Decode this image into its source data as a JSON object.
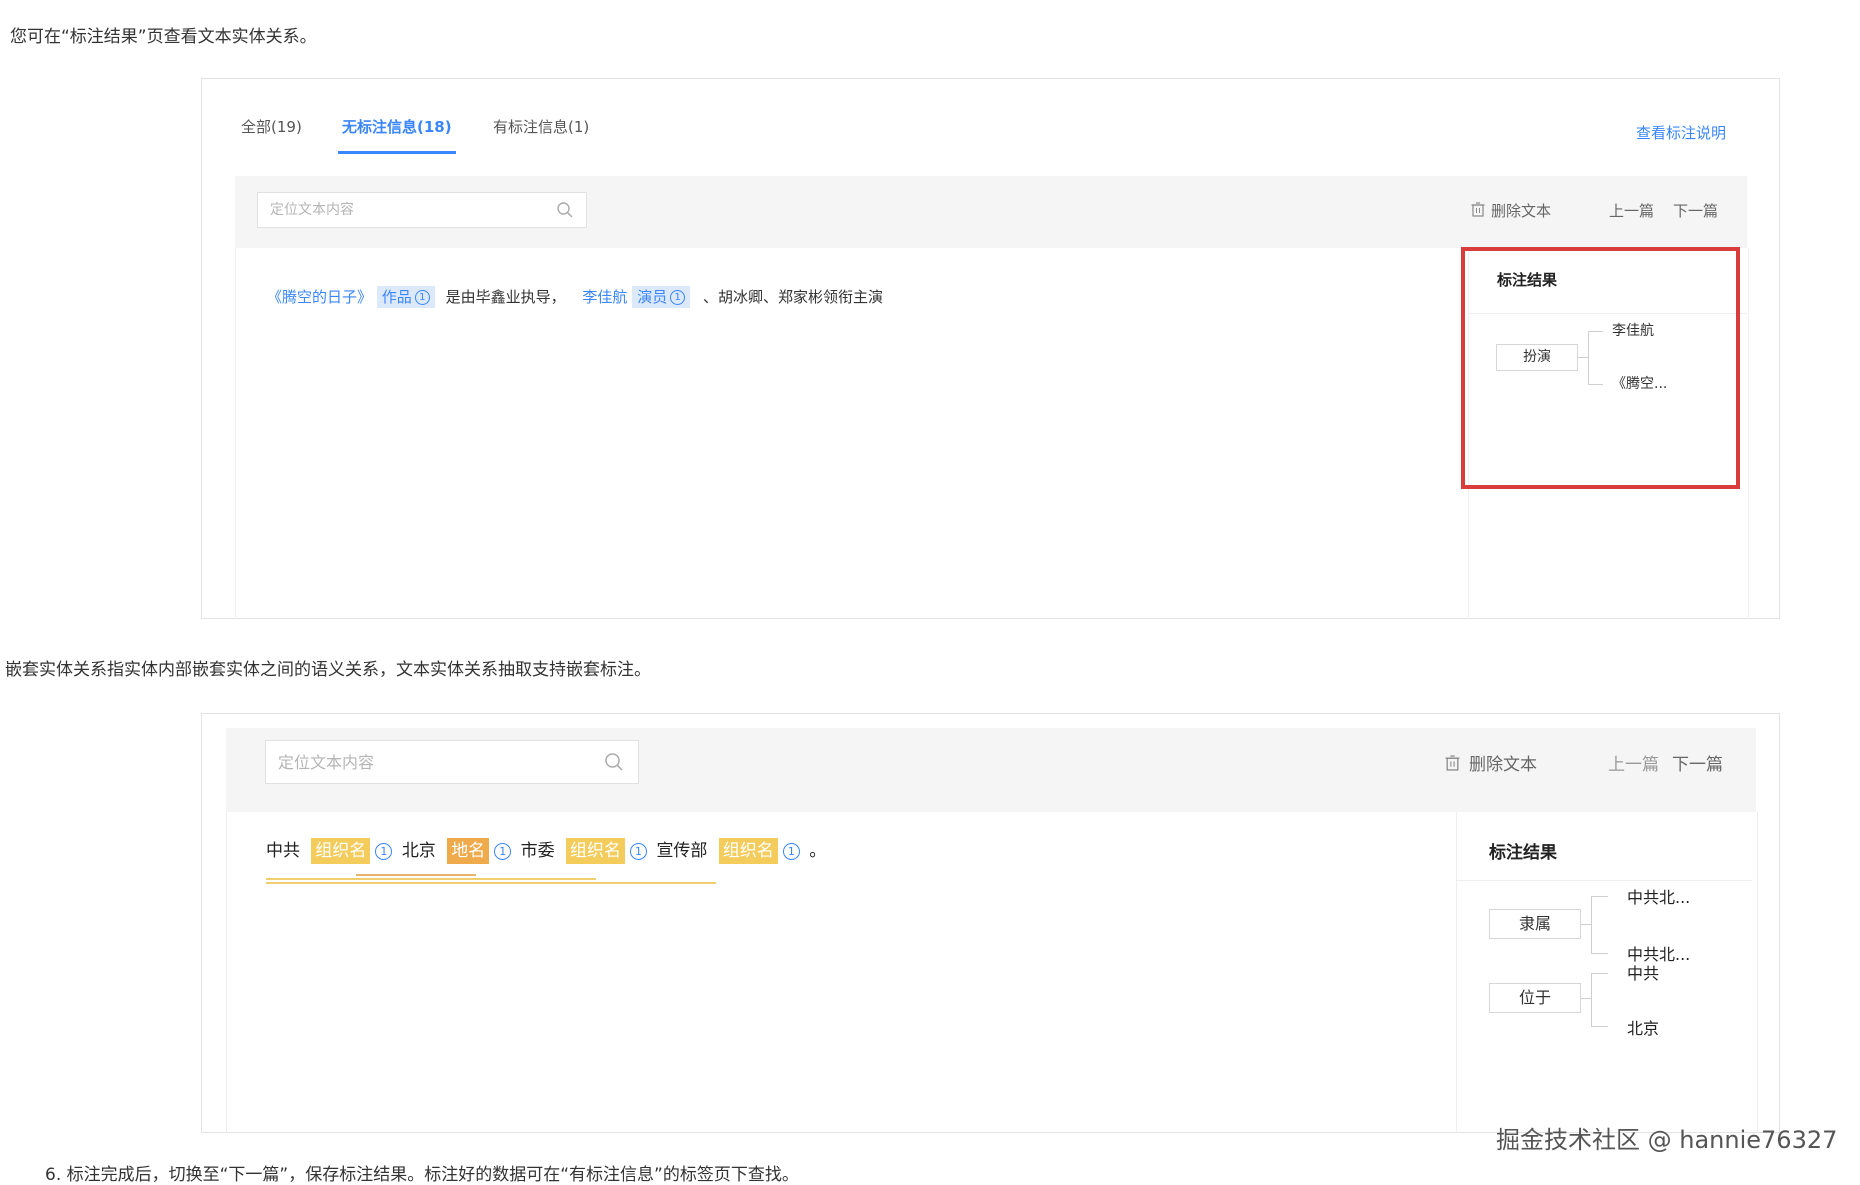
{
  "intro_text": "您可在“标注结果”页查看文本实体关系。",
  "panel1": {
    "tabs": [
      {
        "label": "全部(19)"
      },
      {
        "label": "无标注信息(18)"
      },
      {
        "label": "有标注信息(1)"
      }
    ],
    "help_link": "查看标注说明",
    "search_placeholder": "定位文本内容",
    "delete_label": "删除文本",
    "prev_label": "上一篇",
    "next_label": "下一篇",
    "sentence": {
      "e1": "《腾空的日子》",
      "e1_tag": "作品",
      "e1_num": "1",
      "t1": "是由毕鑫业执导，",
      "e2": "李佳航",
      "e2_tag": "演员",
      "e2_num": "1",
      "t2": "、胡冰卿、郑家彬领衔主演"
    },
    "result": {
      "title": "标注结果",
      "relation": "扮演",
      "targets": [
        "李佳航",
        "《腾空..."
      ]
    }
  },
  "nested_text": "嵌套实体关系指实体内部嵌套实体之间的语义关系，文本实体关系抽取支持嵌套标注。",
  "panel2": {
    "search_placeholder": "定位文本内容",
    "delete_label": "删除文本",
    "prev_label": "上一篇",
    "next_label": "下一篇",
    "sentence": {
      "w1": "中共",
      "tag1": "组织名",
      "n1": "1",
      "w2": "北京",
      "tag2": "地名",
      "n2": "1",
      "w3": "市委",
      "tag3": "组织名",
      "n3": "1",
      "w4": "宣传部",
      "tag4": "组织名",
      "n4": "1",
      "end": "。"
    },
    "result": {
      "title": "标注结果",
      "relations": [
        {
          "label": "隶属",
          "targets": [
            "中共北...",
            "中共北..."
          ]
        },
        {
          "label": "位于",
          "targets": [
            "中共",
            "北京"
          ]
        }
      ]
    }
  },
  "step_text": "6. 标注完成后，切换至“下一篇”，保存标注结果。标注好的数据可在“有标注信息”的标签页下查找。",
  "watermark": "掘金技术社区 @ hannie76327",
  "colors": {
    "accent_blue": "#3a86ff",
    "highlight_red": "#d93c3c",
    "tag_yellow": "#f3cc5c",
    "tag_orange": "#efaa4c"
  }
}
